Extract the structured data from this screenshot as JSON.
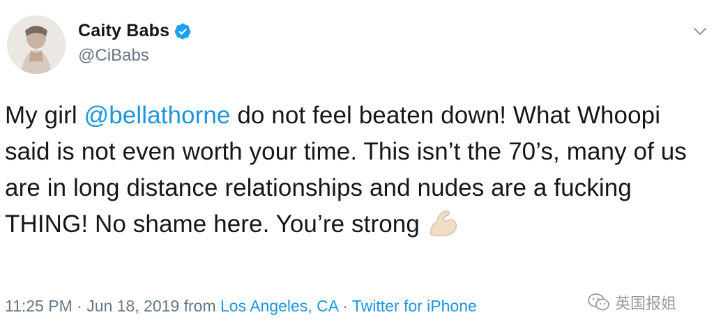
{
  "tweet": {
    "display_name": "Caity Babs",
    "handle": "@CiBabs",
    "text_parts": {
      "p1": "My girl ",
      "mention": "@bellathorne",
      "p2": " do not feel beaten down! What Whoopi said is not even worth your time. This isn’t the 70’s, many of us are in long distance relationships and nudes are a fucking THING! No shame here. You’re strong"
    },
    "emoji": "flexed-biceps",
    "meta": {
      "time": "11:25 PM",
      "sep1": " · ",
      "date": "Jun 18, 2019",
      "from": " from ",
      "location": "Los Angeles, CA",
      "sep2": " · ",
      "source": "Twitter for iPhone"
    }
  },
  "watermark": {
    "text": "英国报姐"
  },
  "colors": {
    "link": "#1b95e0",
    "secondary": "#657786",
    "verified": "#1da1f2",
    "text": "#14171a"
  }
}
